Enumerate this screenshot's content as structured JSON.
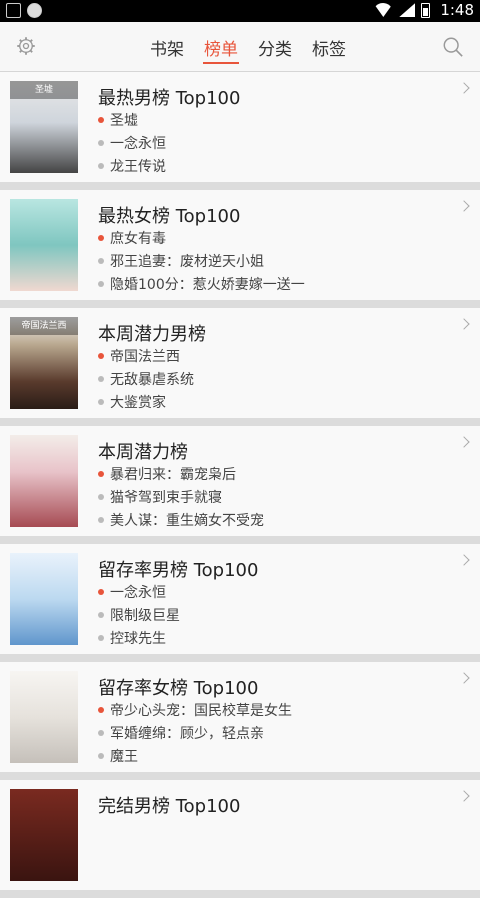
{
  "status": {
    "time": "1:48"
  },
  "header": {
    "tabs": [
      {
        "label": "书架"
      },
      {
        "label": "榜单"
      },
      {
        "label": "分类"
      },
      {
        "label": "标签"
      }
    ],
    "active_tab": 1,
    "accent_color": "#e8553b"
  },
  "cards": [
    {
      "title": "最热男榜 Top100",
      "cover_text": "圣墟",
      "books": [
        "圣墟",
        "一念永恒",
        "龙王传说"
      ]
    },
    {
      "title": "最热女榜 Top100",
      "cover_text": "",
      "books": [
        "庶女有毒",
        "邪王追妻：废材逆天小姐",
        "隐婚100分：惹火娇妻嫁一送一"
      ]
    },
    {
      "title": "本周潜力男榜",
      "cover_text": "帝国法兰西",
      "books": [
        "帝国法兰西",
        "无敌暴虐系统",
        "大鉴赏家"
      ]
    },
    {
      "title": "本周潜力榜",
      "cover_text": "",
      "books": [
        "暴君归来：霸宠枭后",
        "猫爷驾到束手就寝",
        "美人谋：重生嫡女不受宠"
      ]
    },
    {
      "title": "留存率男榜 Top100",
      "cover_text": "",
      "books": [
        "一念永恒",
        "限制级巨星",
        "控球先生"
      ]
    },
    {
      "title": "留存率女榜 Top100",
      "cover_text": "",
      "books": [
        "帝少心头宠：国民校草是女生",
        "军婚缠绵：顾少，轻点亲",
        "魔王"
      ]
    },
    {
      "title": "完结男榜 Top100",
      "cover_text": "",
      "books": []
    }
  ]
}
